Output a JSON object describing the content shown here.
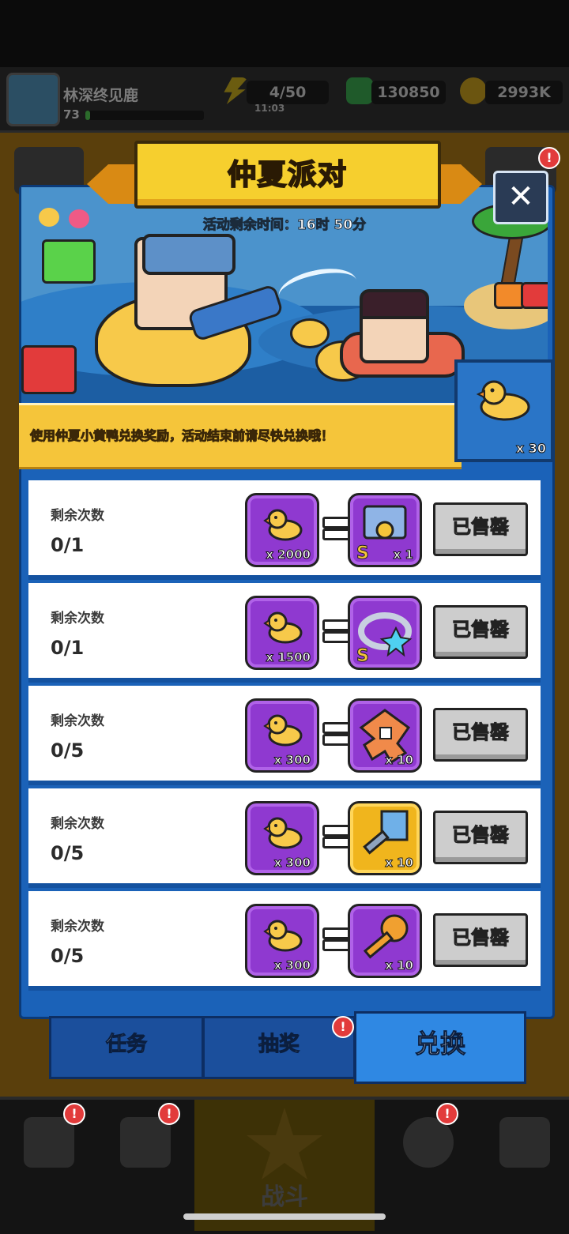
{
  "hud": {
    "player_name": "林深终见鹿",
    "level": "73",
    "energy": "4/50",
    "energy_timer": "11:03",
    "gems": "130850",
    "coins": "2993K"
  },
  "event": {
    "title": "仲夏派对",
    "timer": "活动剩余时间：16时 50分",
    "description": "使用仲夏小黄鸭兑换奖励，活动结束前请尽快兑换哦！",
    "duck_count": "x 30",
    "close_label": "✕"
  },
  "rows": [
    {
      "label": "剩余次数",
      "count": "0/1",
      "cost": "x 2000",
      "reward_qty": "x 1",
      "reward_icon": "s-chest-icon",
      "button": "已售罄"
    },
    {
      "label": "剩余次数",
      "count": "0/1",
      "cost": "x 1500",
      "reward_qty": "",
      "reward_icon": "s-ring-icon",
      "button": "已售罄"
    },
    {
      "label": "剩余次数",
      "count": "0/5",
      "cost": "x 300",
      "reward_qty": "x 10",
      "reward_icon": "puzzle-piece-icon",
      "button": "已售罄"
    },
    {
      "label": "剩余次数",
      "count": "0/5",
      "cost": "x 300",
      "reward_qty": "x 10",
      "reward_icon": "blue-key-icon",
      "button": "已售罄"
    },
    {
      "label": "剩余次数",
      "count": "0/5",
      "cost": "x 300",
      "reward_qty": "x 10",
      "reward_icon": "orange-key-icon",
      "button": "已售罄"
    }
  ],
  "tabs": [
    {
      "label": "任务",
      "active": false
    },
    {
      "label": "抽奖",
      "active": false,
      "badge": "!"
    },
    {
      "label": "兑换",
      "active": true
    }
  ],
  "nav": {
    "battle_label": "战斗",
    "badge": "!"
  },
  "colors": {
    "panel_blue": "#1b62b8",
    "title_yellow": "#f6cf2e",
    "tile_purple": "#8f39d0",
    "tile_gold": "#f0b51d",
    "sold_gray": "#cdcdcd",
    "badge_red": "#e23b3b"
  }
}
